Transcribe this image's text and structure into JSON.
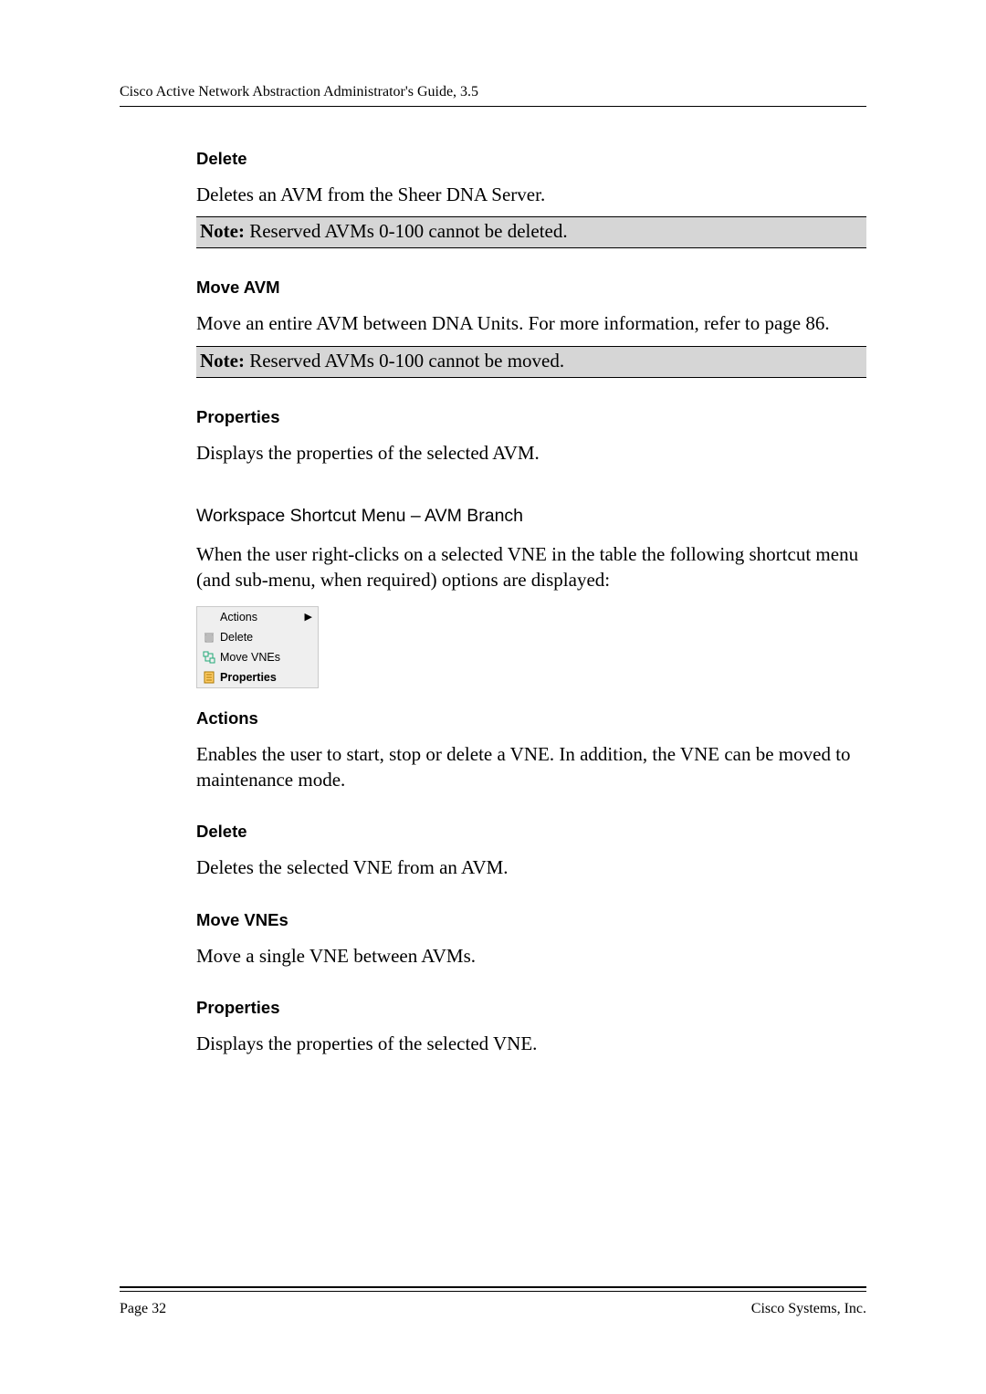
{
  "header": {
    "running_head": "Cisco Active Network Abstraction Administrator's Guide, 3.5"
  },
  "sections": {
    "delete_avm": {
      "heading": "Delete",
      "body": "Deletes an AVM from the Sheer DNA Server.",
      "note_label": "Note:",
      "note_text": " Reserved AVMs 0-100 cannot be deleted."
    },
    "move_avm": {
      "heading": "Move AVM",
      "body": "Move an entire AVM between DNA Units. For more information, refer to page 86.",
      "note_label": "Note:",
      "note_text": " Reserved AVMs 0-100 cannot be moved."
    },
    "properties_avm": {
      "heading": "Properties",
      "body": "Displays the properties of the selected AVM."
    },
    "workspace": {
      "sub_heading": "Workspace Shortcut Menu – AVM Branch",
      "body": "When the user right-clicks on a selected VNE in the table the following shortcut menu (and sub-menu, when required) options are displayed:"
    },
    "menu": {
      "actions": "Actions",
      "delete": "Delete",
      "move_vnes": "Move VNEs",
      "properties": "Properties"
    },
    "actions": {
      "heading": "Actions",
      "body": "Enables the user to start, stop or delete a VNE. In addition, the VNE can be moved to maintenance mode."
    },
    "delete_vne": {
      "heading": "Delete",
      "body": "Deletes the selected VNE from an AVM."
    },
    "move_vnes": {
      "heading": "Move VNEs",
      "body": "Move a single VNE between AVMs."
    },
    "properties_vne": {
      "heading": "Properties",
      "body": "Displays the properties of the selected VNE."
    }
  },
  "footer": {
    "page": "Page 32",
    "company": "Cisco Systems, Inc."
  }
}
